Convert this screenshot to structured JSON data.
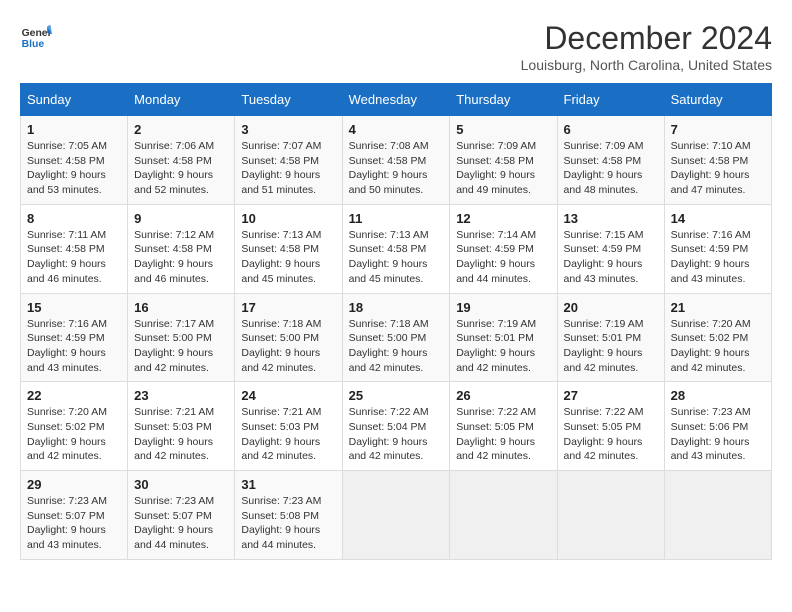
{
  "header": {
    "logo_line1": "General",
    "logo_line2": "Blue",
    "month": "December 2024",
    "location": "Louisburg, North Carolina, United States"
  },
  "weekdays": [
    "Sunday",
    "Monday",
    "Tuesday",
    "Wednesday",
    "Thursday",
    "Friday",
    "Saturday"
  ],
  "weeks": [
    [
      {
        "day": "1",
        "sunrise": "7:05 AM",
        "sunset": "4:58 PM",
        "daylight": "9 hours and 53 minutes."
      },
      {
        "day": "2",
        "sunrise": "7:06 AM",
        "sunset": "4:58 PM",
        "daylight": "9 hours and 52 minutes."
      },
      {
        "day": "3",
        "sunrise": "7:07 AM",
        "sunset": "4:58 PM",
        "daylight": "9 hours and 51 minutes."
      },
      {
        "day": "4",
        "sunrise": "7:08 AM",
        "sunset": "4:58 PM",
        "daylight": "9 hours and 50 minutes."
      },
      {
        "day": "5",
        "sunrise": "7:09 AM",
        "sunset": "4:58 PM",
        "daylight": "9 hours and 49 minutes."
      },
      {
        "day": "6",
        "sunrise": "7:09 AM",
        "sunset": "4:58 PM",
        "daylight": "9 hours and 48 minutes."
      },
      {
        "day": "7",
        "sunrise": "7:10 AM",
        "sunset": "4:58 PM",
        "daylight": "9 hours and 47 minutes."
      }
    ],
    [
      {
        "day": "8",
        "sunrise": "7:11 AM",
        "sunset": "4:58 PM",
        "daylight": "9 hours and 46 minutes."
      },
      {
        "day": "9",
        "sunrise": "7:12 AM",
        "sunset": "4:58 PM",
        "daylight": "9 hours and 46 minutes."
      },
      {
        "day": "10",
        "sunrise": "7:13 AM",
        "sunset": "4:58 PM",
        "daylight": "9 hours and 45 minutes."
      },
      {
        "day": "11",
        "sunrise": "7:13 AM",
        "sunset": "4:58 PM",
        "daylight": "9 hours and 45 minutes."
      },
      {
        "day": "12",
        "sunrise": "7:14 AM",
        "sunset": "4:59 PM",
        "daylight": "9 hours and 44 minutes."
      },
      {
        "day": "13",
        "sunrise": "7:15 AM",
        "sunset": "4:59 PM",
        "daylight": "9 hours and 43 minutes."
      },
      {
        "day": "14",
        "sunrise": "7:16 AM",
        "sunset": "4:59 PM",
        "daylight": "9 hours and 43 minutes."
      }
    ],
    [
      {
        "day": "15",
        "sunrise": "7:16 AM",
        "sunset": "4:59 PM",
        "daylight": "9 hours and 43 minutes."
      },
      {
        "day": "16",
        "sunrise": "7:17 AM",
        "sunset": "5:00 PM",
        "daylight": "9 hours and 42 minutes."
      },
      {
        "day": "17",
        "sunrise": "7:18 AM",
        "sunset": "5:00 PM",
        "daylight": "9 hours and 42 minutes."
      },
      {
        "day": "18",
        "sunrise": "7:18 AM",
        "sunset": "5:00 PM",
        "daylight": "9 hours and 42 minutes."
      },
      {
        "day": "19",
        "sunrise": "7:19 AM",
        "sunset": "5:01 PM",
        "daylight": "9 hours and 42 minutes."
      },
      {
        "day": "20",
        "sunrise": "7:19 AM",
        "sunset": "5:01 PM",
        "daylight": "9 hours and 42 minutes."
      },
      {
        "day": "21",
        "sunrise": "7:20 AM",
        "sunset": "5:02 PM",
        "daylight": "9 hours and 42 minutes."
      }
    ],
    [
      {
        "day": "22",
        "sunrise": "7:20 AM",
        "sunset": "5:02 PM",
        "daylight": "9 hours and 42 minutes."
      },
      {
        "day": "23",
        "sunrise": "7:21 AM",
        "sunset": "5:03 PM",
        "daylight": "9 hours and 42 minutes."
      },
      {
        "day": "24",
        "sunrise": "7:21 AM",
        "sunset": "5:03 PM",
        "daylight": "9 hours and 42 minutes."
      },
      {
        "day": "25",
        "sunrise": "7:22 AM",
        "sunset": "5:04 PM",
        "daylight": "9 hours and 42 minutes."
      },
      {
        "day": "26",
        "sunrise": "7:22 AM",
        "sunset": "5:05 PM",
        "daylight": "9 hours and 42 minutes."
      },
      {
        "day": "27",
        "sunrise": "7:22 AM",
        "sunset": "5:05 PM",
        "daylight": "9 hours and 42 minutes."
      },
      {
        "day": "28",
        "sunrise": "7:23 AM",
        "sunset": "5:06 PM",
        "daylight": "9 hours and 43 minutes."
      }
    ],
    [
      {
        "day": "29",
        "sunrise": "7:23 AM",
        "sunset": "5:07 PM",
        "daylight": "9 hours and 43 minutes."
      },
      {
        "day": "30",
        "sunrise": "7:23 AM",
        "sunset": "5:07 PM",
        "daylight": "9 hours and 44 minutes."
      },
      {
        "day": "31",
        "sunrise": "7:23 AM",
        "sunset": "5:08 PM",
        "daylight": "9 hours and 44 minutes."
      },
      null,
      null,
      null,
      null
    ]
  ],
  "labels": {
    "sunrise": "Sunrise:",
    "sunset": "Sunset:",
    "daylight": "Daylight:"
  }
}
